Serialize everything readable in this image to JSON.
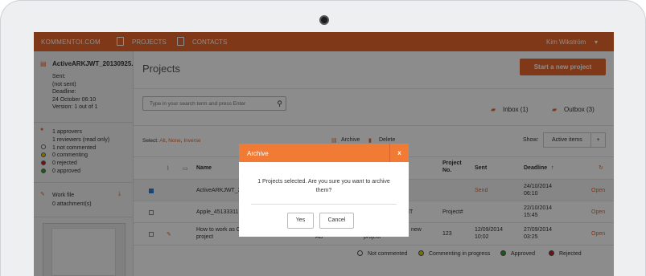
{
  "app": {
    "logo": "KOMMENTOI.COM",
    "nav": [
      "PROJECTS",
      "CONTACTS"
    ],
    "user": "Kim Wikström"
  },
  "sidebar": {
    "file_name": "ActiveARKJWT_20130925.p",
    "sent": "Sent:",
    "sent_val": "(not sent)",
    "deadline": "Deadline:",
    "deadline_val": "24 October 06:10",
    "version": "Version: 1 out of 1",
    "stats": [
      "1 approvers",
      "1 reviewers (read only)",
      "1 not commented",
      "0 commenting",
      "0 rejected",
      "0 approved"
    ],
    "work_file": "Work file",
    "attachments": "0 attachment(s)"
  },
  "main": {
    "title": "Projects",
    "start_button": "Start a new project",
    "search_placeholder": "Type in your search term and press Enter",
    "inbox": "Inbox (1)",
    "outbox": "Outbox (3)",
    "select_prefix": "Select:",
    "select_all": "All",
    "select_none": "None",
    "select_inverse": "Inverse",
    "archive": "Archive",
    "delete": "Delete",
    "show_label": "Show:",
    "show_value": "Active items",
    "columns": {
      "name": "Name",
      "project_no_1": "Project",
      "project_no_2": "No.",
      "sent": "Sent",
      "deadline": "Deadline"
    },
    "rows": [
      {
        "name": "ActiveARKJWT_2",
        "project_no": "",
        "sent": "Send",
        "deadline_1": "24/10/2014",
        "deadline_2": "06:10",
        "action": "Open"
      },
      {
        "name": "Apple_45133311",
        "mid": "IT",
        "project_no": "Project#",
        "sent": "",
        "deadline_1": "22/10/2014",
        "deadline_2": "15:45",
        "action": "Open"
      },
      {
        "name_1": "How to work as C",
        "name_2": "project",
        "mid_1": "new",
        "mid_2": "project",
        "mid_left": "AB",
        "project_no": "123",
        "sent_1": "12/09/2014",
        "sent_2": "10:02",
        "deadline_1": "27/09/2014",
        "deadline_2": "03:25",
        "action": "Open"
      }
    ],
    "legend": [
      "Not commented",
      "Commenting in progress",
      "Approved",
      "Rejected"
    ],
    "legend_colors": [
      "#ffffff",
      "#e8c800",
      "#2aa52a",
      "#cc1f1f"
    ]
  },
  "dialog": {
    "title": "Archive",
    "close": "x",
    "message": "1 Projects selected. Are you sure you want to archive them?",
    "yes": "Yes",
    "cancel": "Cancel"
  }
}
